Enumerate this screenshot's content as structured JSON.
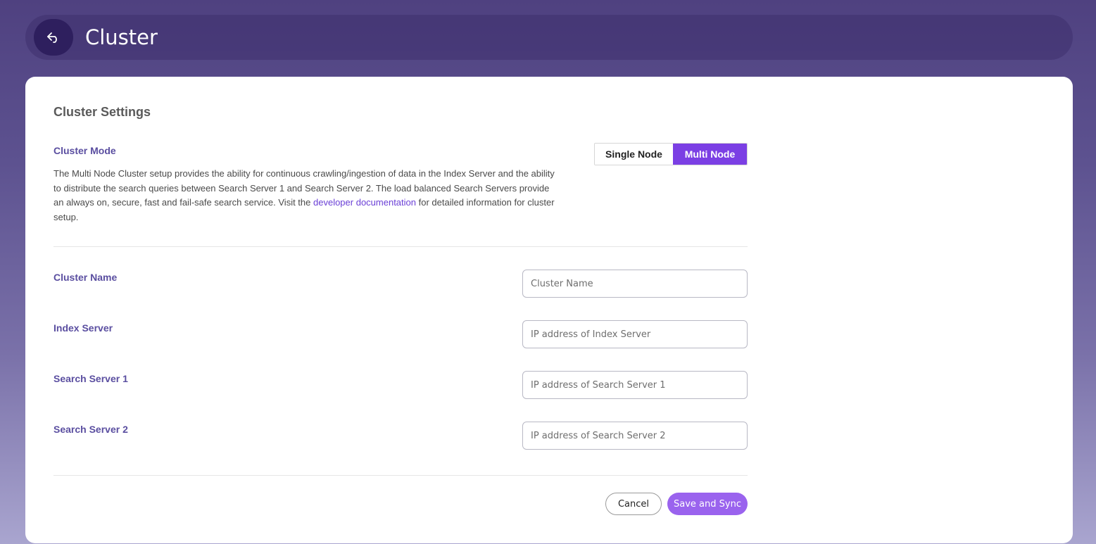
{
  "header": {
    "title": "Cluster",
    "back_icon": "back-arrow-icon"
  },
  "settings": {
    "title": "Cluster Settings",
    "mode": {
      "label": "Cluster Mode",
      "description_before_link": "The Multi Node Cluster setup provides the ability for continuous crawling/ingestion of data in the Index Server and the ability to distribute the search queries between Search Server 1 and Search Server 2. The load balanced Search Servers provide an always on, secure, fast and fail-safe search service. Visit the ",
      "link_text": "developer documentation",
      "description_after_link": " for detailed information for cluster setup.",
      "options": [
        "Single Node",
        "Multi Node"
      ],
      "selected": "Multi Node"
    },
    "fields": {
      "cluster_name": {
        "label": "Cluster Name",
        "placeholder": "Cluster Name",
        "value": ""
      },
      "index_server": {
        "label": "Index Server",
        "placeholder": "IP address of Index Server",
        "value": ""
      },
      "search_server_1": {
        "label": "Search Server 1",
        "placeholder": "IP address of Search Server 1",
        "value": ""
      },
      "search_server_2": {
        "label": "Search Server 2",
        "placeholder": "IP address of Search Server 2",
        "value": ""
      }
    },
    "actions": {
      "cancel_label": "Cancel",
      "save_label": "Save and Sync"
    }
  },
  "colors": {
    "accent": "#7b3fe4",
    "save_button": "#9a63ee",
    "label": "#5a4ea0",
    "link": "#6a3fd6"
  }
}
